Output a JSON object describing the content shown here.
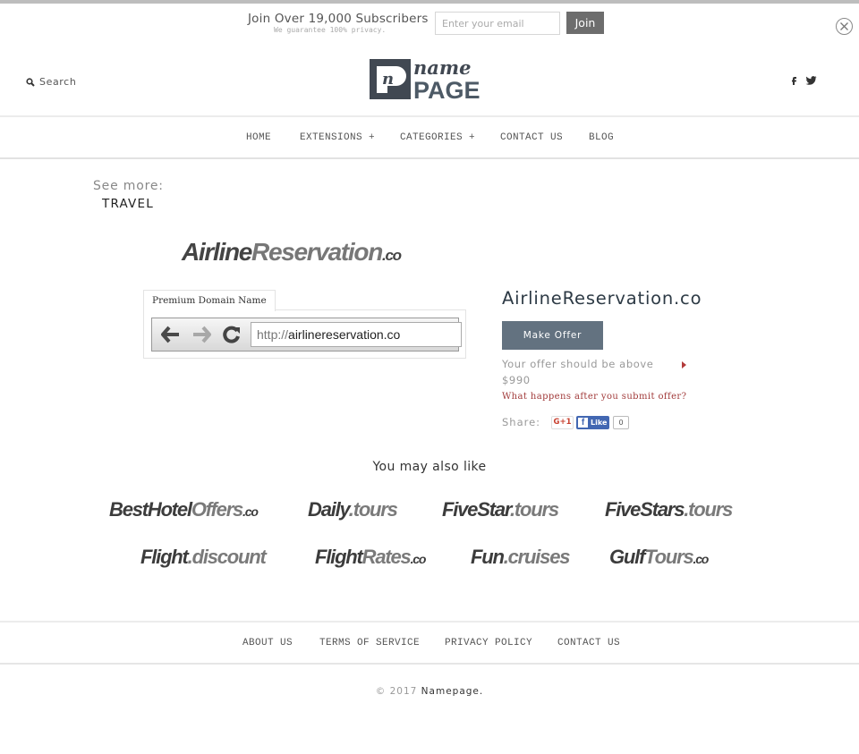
{
  "subscribe": {
    "title": "Join Over 19,000 Subscribers",
    "note": "We guarantee 100% privacy.",
    "email_placeholder": "Enter your email",
    "email_value": "",
    "join_label": "Join"
  },
  "header": {
    "search_label": "Search",
    "logo_top": "name",
    "logo_bottom": "PAGE",
    "social": [
      "facebook",
      "twitter"
    ]
  },
  "nav": {
    "items": [
      {
        "label": "HOME"
      },
      {
        "label": "EXTENSIONS +"
      },
      {
        "label": "CATEGORIES +"
      },
      {
        "label": "CONTACT US"
      },
      {
        "label": "BLOG"
      }
    ]
  },
  "breadcrumb": {
    "see_more": "See more:",
    "category": "TRAVEL"
  },
  "domain_logo": {
    "part1": "Airline",
    "part2": "Reservation",
    "tld": ".co"
  },
  "preview": {
    "tab_label": "Premium Domain Name",
    "url_protocol": "http://",
    "url_host": "airlinereservation.co"
  },
  "product": {
    "title": "AirlineReservation.co",
    "make_offer_label": "Make Offer",
    "offer_text": "Your offer should be above",
    "offer_price": "$990",
    "what_happens_link": "What happens after you submit offer?",
    "share_label": "Share:",
    "gplus_label": "G+1",
    "fb_like_label": "Like",
    "fb_like_count": "0"
  },
  "recommendations": {
    "heading": "You may also like",
    "items": [
      {
        "a": "BestHotel",
        "b": "Offers",
        "c": ".co"
      },
      {
        "a": "Daily",
        "b": ".tours",
        "c": ""
      },
      {
        "a": "FiveStar",
        "b": ".tours",
        "c": ""
      },
      {
        "a": "FiveStars",
        "b": ".tours",
        "c": ""
      },
      {
        "a": "Flight",
        "b": ".discount",
        "c": ""
      },
      {
        "a": "Flight",
        "b": "Rates",
        "c": ".co"
      },
      {
        "a": "Fun",
        "b": ".cruises",
        "c": ""
      },
      {
        "a": "Gulf",
        "b": "Tours",
        "c": ".co"
      }
    ]
  },
  "footer": {
    "links": [
      {
        "label": "ABOUT US"
      },
      {
        "label": "TERMS OF SERVICE"
      },
      {
        "label": "PRIVACY POLICY"
      },
      {
        "label": "CONTACT US"
      }
    ],
    "copyright": "© 2017",
    "brand": "Namepage."
  },
  "colors": {
    "accent_button": "#637280",
    "link_red": "#a13a3a",
    "join_button": "#6d6d6d",
    "facebook_blue": "#4267b2"
  }
}
